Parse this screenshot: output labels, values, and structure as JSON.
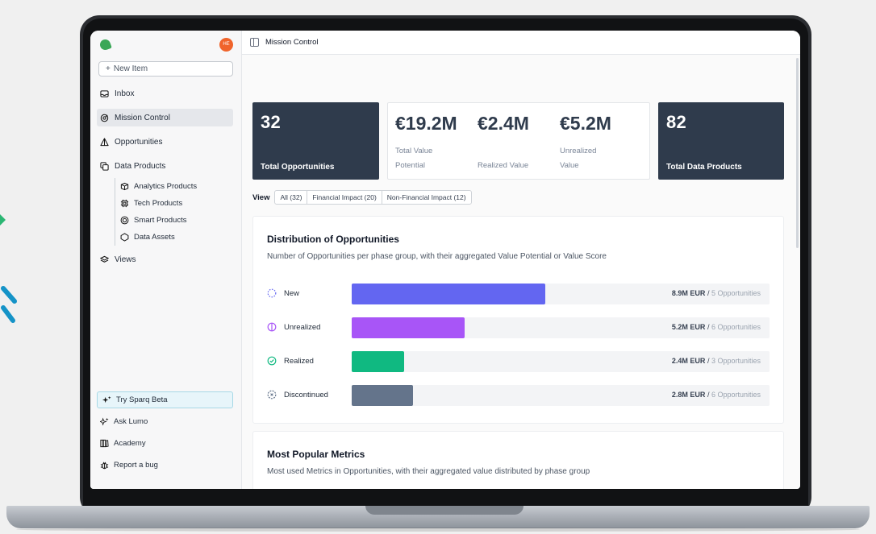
{
  "sidebar": {
    "avatar_initials": "HE",
    "new_item_label": "New Item",
    "items": [
      {
        "label": "Inbox",
        "icon": "inbox-icon"
      },
      {
        "label": "Mission Control",
        "icon": "mission-control-icon",
        "active": true
      },
      {
        "label": "Opportunities",
        "icon": "opportunities-icon"
      },
      {
        "label": "Data Products",
        "icon": "data-products-icon"
      }
    ],
    "sub_items": [
      {
        "label": "Analytics Products",
        "icon": "analytics-products-icon"
      },
      {
        "label": "Tech Products",
        "icon": "tech-products-icon"
      },
      {
        "label": "Smart Products",
        "icon": "smart-products-icon"
      },
      {
        "label": "Data Assets",
        "icon": "data-assets-icon"
      }
    ],
    "views_label": "Views",
    "bottom": {
      "beta_label": "Try Sparq Beta",
      "ask_lumo_label": "Ask Lumo",
      "academy_label": "Academy",
      "report_bug_label": "Report a bug"
    }
  },
  "topbar": {
    "title": "Mission Control"
  },
  "kpis": {
    "total_opportunities": {
      "value": "32",
      "label": "Total Opportunities"
    },
    "total_value_potential": {
      "value": "€19.2M",
      "label": "Total Value Potential"
    },
    "realized_value": {
      "value": "€2.4M",
      "label": "Realized Value"
    },
    "unrealized_value": {
      "value": "€5.2M",
      "label": "Unrealized Value"
    },
    "total_data_products": {
      "value": "82",
      "label": "Total Data Products"
    }
  },
  "view_filter": {
    "label": "View",
    "tabs": [
      "All (32)",
      "Financial Impact (20)",
      "Non-Financial Impact (12)"
    ]
  },
  "distribution": {
    "title": "Distribution of Opportunities",
    "subtitle": "Number of Opportunities per phase group, with their aggregated Value Potential or Value Score",
    "scale_max_eur_m": 19.2,
    "rows": [
      {
        "status": "New",
        "value_eur_m": 8.9,
        "value_label": "8.9M EUR",
        "separator": " / ",
        "count_label": "5 Opportunities",
        "color": "#6366f1"
      },
      {
        "status": "Unrealized",
        "value_eur_m": 5.2,
        "value_label": "5.2M EUR",
        "separator": " / ",
        "count_label": "6 Opportunities",
        "color": "#a855f7"
      },
      {
        "status": "Realized",
        "value_eur_m": 2.4,
        "value_label": "2.4M EUR",
        "separator": " / ",
        "count_label": "3 Opportunities",
        "color": "#10b981"
      },
      {
        "status": "Discontinued",
        "value_eur_m": 2.8,
        "value_label": "2.8M EUR",
        "separator": " / ",
        "count_label": "6 Opportunities",
        "color": "#64748b"
      }
    ]
  },
  "metrics": {
    "title": "Most Popular Metrics",
    "subtitle": "Most used Metrics in Opportunities, with their aggregated value distributed by phase group"
  },
  "colors": {
    "accent_dark": "#2f3b4c",
    "beta_highlight": "#e7f5fa",
    "logo_green": "#3aa757",
    "avatar_orange": "#f0642b"
  }
}
